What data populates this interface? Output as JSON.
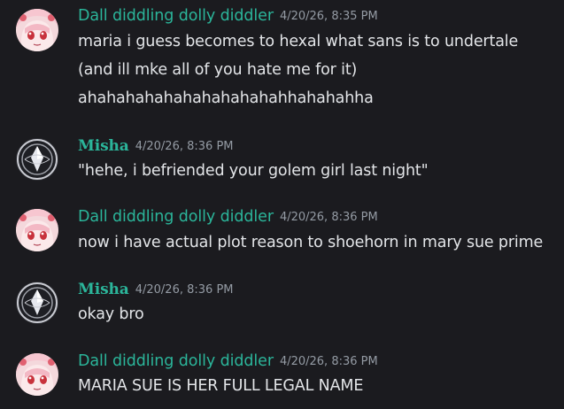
{
  "messages": [
    {
      "author": "Dall diddling dolly diddler",
      "timestamp": "4/20/26, 8:35 PM",
      "lines": [
        "maria i guess becomes to hexal what sans is to undertale",
        "(and ill mke all of you hate me for it)",
        "ahahahahahahahahahahahhahahahha"
      ]
    },
    {
      "author": "Misha",
      "timestamp": "4/20/26, 8:36 PM",
      "lines": [
        "\"hehe, i befriended your golem girl last night\""
      ]
    },
    {
      "author": "Dall diddling dolly diddler",
      "timestamp": "4/20/26, 8:36 PM",
      "lines": [
        "now i have actual plot reason to shoehorn in mary sue prime"
      ]
    },
    {
      "author": "Misha",
      "timestamp": "4/20/26, 8:36 PM",
      "lines": [
        "okay bro"
      ]
    },
    {
      "author": "Dall diddling dolly diddler",
      "timestamp": "4/20/26, 8:36 PM",
      "lines": [
        "MARIA SUE IS HER FULL LEGAL NAME"
      ]
    }
  ],
  "colors": {
    "background": "#1b1b1f",
    "username": "#2bb59a",
    "timestamp": "#949ba4",
    "text": "#e3e5e8"
  }
}
